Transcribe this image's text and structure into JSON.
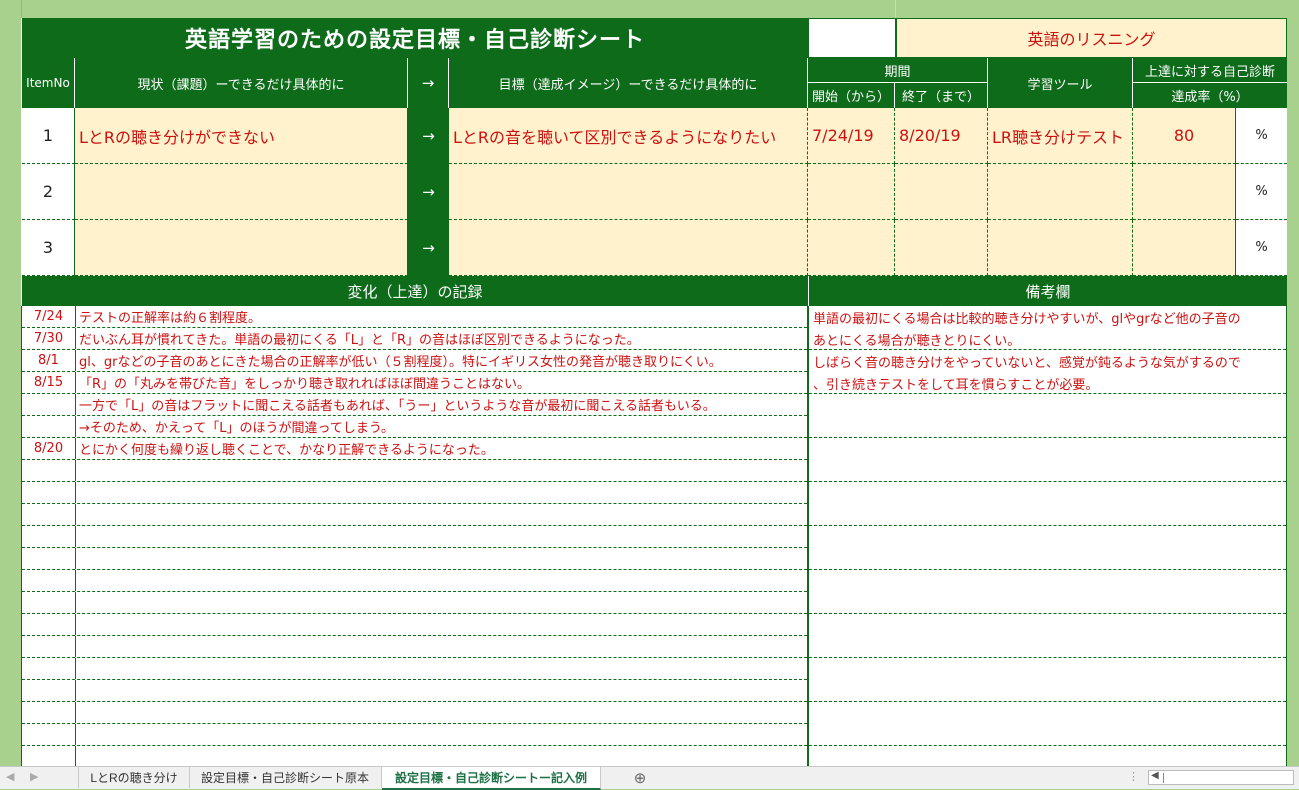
{
  "title": "英語学習のための設定目標・自己診断シート",
  "subject_label": "英語のリスニング",
  "header": {
    "itemno": "ItemNo",
    "current": "現状（課題）ーできるだけ具体的に",
    "arrow": "→",
    "goal": "目標（達成イメージ）ーできるだけ具体的に",
    "period": "期間",
    "start": "開始（から）",
    "end": "終了（まで）",
    "tool": "学習ツール",
    "selfcheck": "上達に対する自己診断",
    "rate": "達成率（%）"
  },
  "items": [
    {
      "no": "1",
      "current": "LとRの聴き分けができない",
      "arrow": "→",
      "goal": "LとRの音を聴いて区別できるようになりたい",
      "start": "7/24/19",
      "end": "8/20/19",
      "tool": "LR聴き分けテスト",
      "rate": "80",
      "pct": "%"
    },
    {
      "no": "2",
      "current": "",
      "arrow": "→",
      "goal": "",
      "start": "",
      "end": "",
      "tool": "",
      "rate": "",
      "pct": "%"
    },
    {
      "no": "3",
      "current": "",
      "arrow": "→",
      "goal": "",
      "start": "",
      "end": "",
      "tool": "",
      "rate": "",
      "pct": "%"
    }
  ],
  "log_header": "変化（上達）の記録",
  "notes_header": "備考欄",
  "log": [
    {
      "date": "7/24",
      "text": "テストの正解率は約６割程度。"
    },
    {
      "date": "7/30",
      "text": "だいぶん耳が慣れてきた。単語の最初にくる「L」と「R」の音はほぼ区別できるようになった。"
    },
    {
      "date": "8/1",
      "text": "gl、grなどの子音のあとにきた場合の正解率が低い（５割程度）。特にイギリス女性の発音が聴き取りにくい。"
    },
    {
      "date": "8/15",
      "text": "「R」の「丸みを帯びた音」をしっかり聴き取れればほぼ間違うことはない。"
    },
    {
      "date": "",
      "text": "一方で「L」の音はフラットに聞こえる話者もあれば、「うー」というような音が最初に聞こえる話者もいる。"
    },
    {
      "date": "",
      "text": "→そのため、かえって「L」のほうが間違ってしまう。"
    },
    {
      "date": "8/20",
      "text": "とにかく何度も繰り返し聴くことで、かなり正解できるようになった。"
    }
  ],
  "notes": [
    "単語の最初にくる場合は比較的聴き分けやすいが、glやgrなど他の子音の",
    "あとにくる場合が聴きとりにくい。",
    "しばらく音の聴き分けをやっていないと、感覚が鈍るような気がするので",
    "、引き続きテストをして耳を慣らすことが必要。"
  ],
  "tabs": {
    "tab1": "LとRの聴き分け",
    "tab2": "設定目標・自己診断シート原本",
    "tab3": "設定目標・自己診断シートー記入例",
    "add": "⊕"
  },
  "colors": {
    "green": "#0d6b1a",
    "cream": "#fff2cc",
    "red": "#cc1111"
  }
}
